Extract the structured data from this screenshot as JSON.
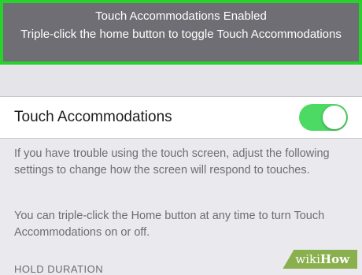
{
  "banner": {
    "title": "Touch Accommodations Enabled",
    "subtitle": "Triple-click the home button to toggle Touch Accommodations"
  },
  "setting": {
    "label": "Touch Accommodations",
    "toggle_on": true,
    "accent": "#4cd964"
  },
  "footer": {
    "para1": "If you have trouble using the touch screen, adjust the following settings to change how the screen will respond to touches.",
    "para2": "You can triple-click the Home button at any time to turn Touch Accommodations on or off."
  },
  "section": {
    "header": "HOLD DURATION"
  },
  "watermark": {
    "prefix": "wiki",
    "suffix": "How"
  },
  "colors": {
    "banner_border": "#28d12b",
    "banner_bg": "#6e6e74"
  }
}
